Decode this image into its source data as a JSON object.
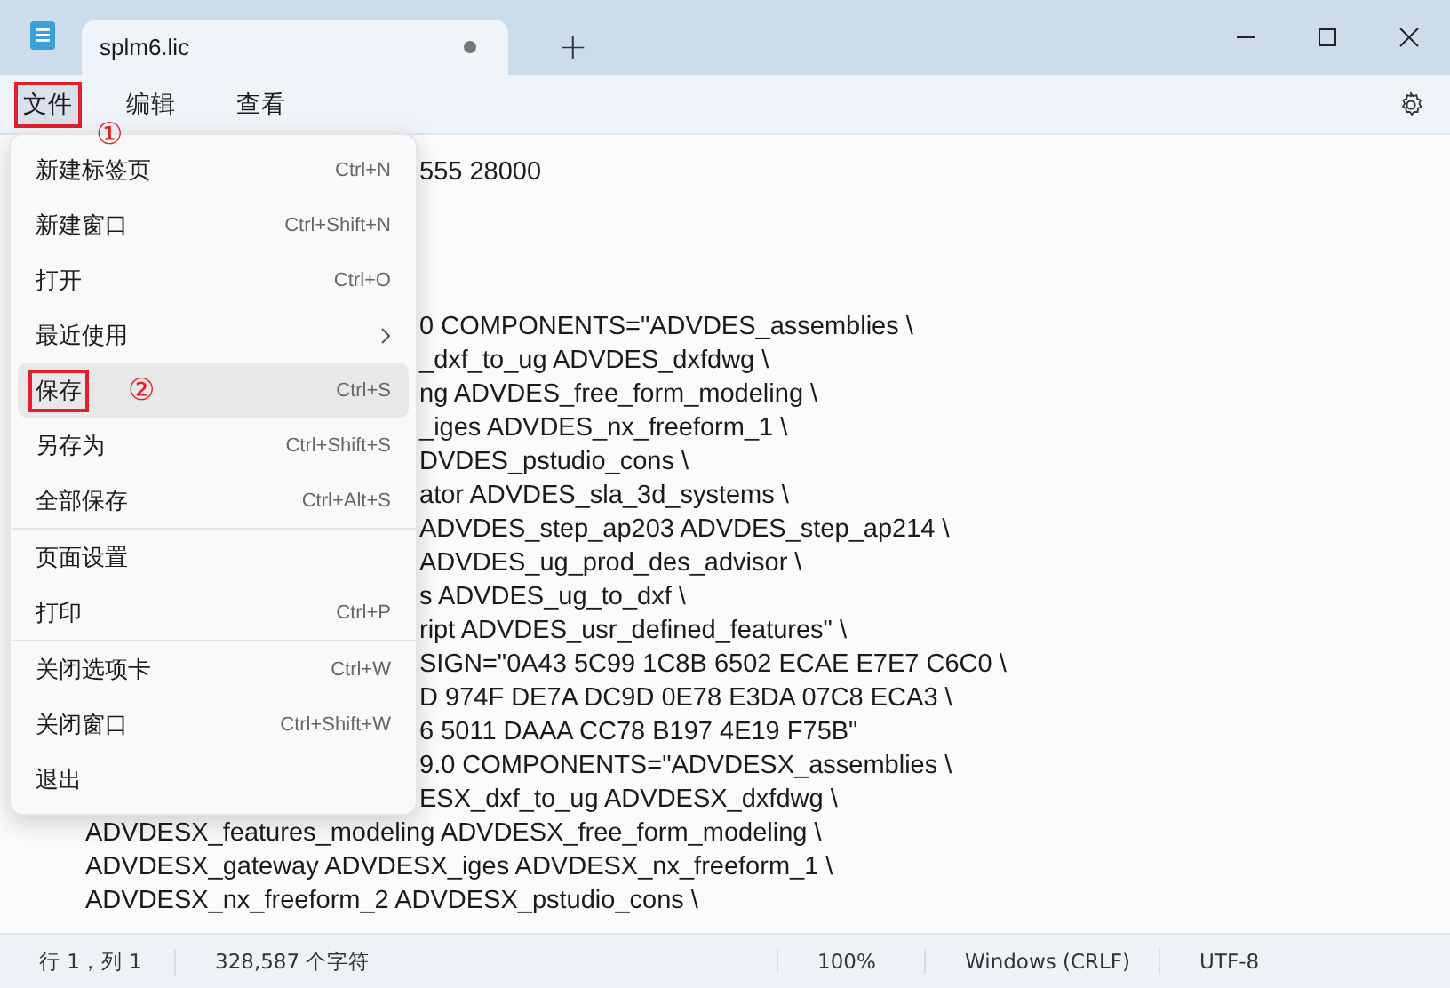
{
  "tab": {
    "title": "splm6.lic",
    "modified": true,
    "new_tab": "+"
  },
  "menubar": [
    {
      "label": "文件",
      "selected": true,
      "outlined": true,
      "annotation": "①"
    },
    {
      "label": "编辑",
      "selected": false,
      "outlined": false
    },
    {
      "label": "查看",
      "selected": false,
      "outlined": false
    }
  ],
  "menu": [
    {
      "label": "新建标签页",
      "shortcut": "Ctrl+N",
      "selected": false,
      "outlined": false
    },
    {
      "label": "新建窗口",
      "shortcut": "Ctrl+Shift+N",
      "selected": false,
      "outlined": false
    },
    {
      "label": "打开",
      "shortcut": "Ctrl+O",
      "selected": false,
      "outlined": false
    },
    {
      "label": "最近使用",
      "submenu": true,
      "selected": false,
      "outlined": false
    },
    {
      "label": "保存",
      "shortcut": "Ctrl+S",
      "selected": true,
      "outlined": true,
      "annotation": "②"
    },
    {
      "label": "另存为",
      "shortcut": "Ctrl+Shift+S",
      "selected": false,
      "outlined": false
    },
    {
      "label": "全部保存",
      "shortcut": "Ctrl+Alt+S",
      "selected": false,
      "outlined": false,
      "divider_after": true
    },
    {
      "label": "页面设置",
      "selected": false,
      "outlined": false
    },
    {
      "label": "打印",
      "shortcut": "Ctrl+P",
      "selected": false,
      "outlined": false,
      "divider_after": true
    },
    {
      "label": "关闭选项卡",
      "shortcut": "Ctrl+W",
      "selected": false,
      "outlined": false
    },
    {
      "label": "关闭窗口",
      "shortcut": "Ctrl+Shift+W",
      "selected": false,
      "outlined": false
    },
    {
      "label": "退出",
      "selected": false,
      "outlined": false
    }
  ],
  "editor": {
    "top_lines_beside_menu": [
      "555 28000"
    ],
    "lines_beside_menu": [
      "0 COMPONENTS=\"ADVDES_assemblies \\",
      "_dxf_to_ug ADVDES_dxfdwg \\",
      "ng ADVDES_free_form_modeling \\",
      "_iges ADVDES_nx_freeform_1 \\",
      "DVDES_pstudio_cons \\",
      "ator ADVDES_sla_3d_systems \\",
      "ADVDES_step_ap203 ADVDES_step_ap214 \\",
      "ADVDES_ug_prod_des_advisor \\",
      "s ADVDES_ug_to_dxf \\",
      "ript ADVDES_usr_defined_features\" \\",
      "SIGN=\"0A43 5C99 1C8B 6502 ECAE E7E7 C6C0 \\",
      "D 974F DE7A DC9D 0E78 E3DA 07C8 ECA3 \\",
      "6 5011 DAAA CC78 B197 4E19 F75B\"",
      "9.0 COMPONENTS=\"ADVDESX_assemblies \\",
      "ESX_dxf_to_ug ADVDESX_dxfdwg \\"
    ],
    "lines": [
      "ADVDESX_features_modeling ADVDESX_free_form_modeling \\",
      "ADVDESX_gateway ADVDESX_iges ADVDESX_nx_freeform_1 \\",
      "ADVDESX_nx_freeform_2 ADVDESX_pstudio_cons \\"
    ]
  },
  "status_bar": {
    "position": "行 1，列 1",
    "characters": "328,587 个字符",
    "zoom": "100%",
    "line_ending": "Windows (CRLF)",
    "encoding": "UTF-8"
  }
}
